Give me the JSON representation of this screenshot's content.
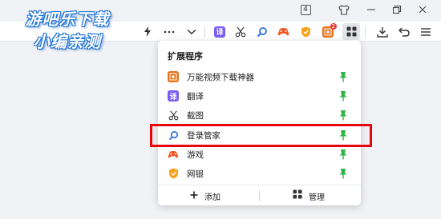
{
  "watermark": {
    "line1": "游吧乐下载",
    "line2": "小编亲测"
  },
  "titlebar": {
    "tab_count": "4",
    "icons": [
      "tab-counter-icon",
      "shirt-icon",
      "minimize-icon",
      "restore-icon",
      "close-icon"
    ]
  },
  "toolbar": {
    "icons": [
      "lightning-icon",
      "more-icon",
      "chevron-down-icon",
      "translate-ext-icon",
      "scissors-ext-icon",
      "search-ext-icon",
      "game-ext-icon",
      "shield-ext-icon",
      "video-ext-icon",
      "extensions-grid-icon",
      "download-icon",
      "undo-icon",
      "menu-icon"
    ],
    "video_badge": "2",
    "translate_glyph": "译"
  },
  "extensions_panel": {
    "title": "扩展程序",
    "items": [
      {
        "label": "万能视频下载神器",
        "icon": "video-download-icon",
        "pinned": true
      },
      {
        "label": "翻译",
        "icon": "translate-icon",
        "glyph": "译",
        "pinned": true
      },
      {
        "label": "截图",
        "icon": "scissors-icon",
        "pinned": true
      },
      {
        "label": "登录管家",
        "icon": "search-icon",
        "pinned": true
      },
      {
        "label": "游戏",
        "icon": "game-icon",
        "pinned": true
      },
      {
        "label": "网银",
        "icon": "shield-icon",
        "pinned": true
      }
    ],
    "add_label": "添加",
    "manage_label": "管理"
  },
  "colors": {
    "pin_green": "#2fb344",
    "highlight_red": "#e8060b",
    "translate_purple": "#7b5cf0",
    "game_orange": "#f05a28",
    "shield_orange": "#f7a21b",
    "search_blue": "#2b6fe0"
  }
}
